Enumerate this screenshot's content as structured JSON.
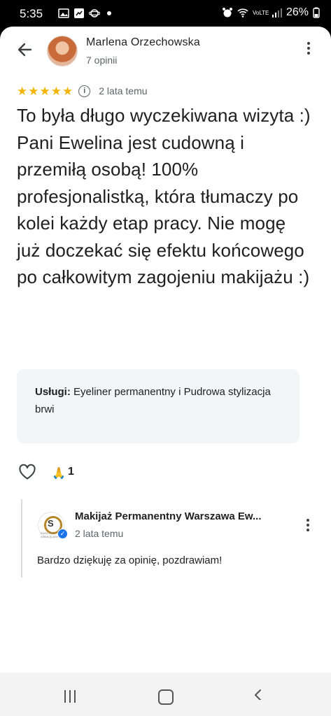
{
  "status_bar": {
    "time": "5:35",
    "battery": "26%",
    "network_label": "VoLTE"
  },
  "review": {
    "author_name": "Marlena Orzechowska",
    "author_meta": "7 opinii",
    "rating": 5,
    "stars": [
      "★",
      "★",
      "★",
      "★",
      "★"
    ],
    "date": "2 lata temu",
    "text": "To była długo wyczekiwana wizyta :) Pani Ewelina jest cudowną i przemiłą osobą! 100% profesjonalistką, która tłumaczy po kolei każdy etap pracy. Nie mogę już doczekać się efektu końcowego po całkowitym zagojeniu makijażu :)",
    "services_label": "Usługi:",
    "services_value": "Eyeliner permanentny i Pudrowa stylizacja brwi",
    "reaction_emoji": "🙏",
    "reaction_count": "1"
  },
  "reply": {
    "owner_name": "Makijaż Permanentny Warszawa Ew...",
    "date": "2 lata temu",
    "text": "Bardzo dziękuję za opinię, pozdrawiam!",
    "logo_initial": "S",
    "logo_caption": "EWELINA ANDRZEJEWSKA"
  },
  "colors": {
    "star": "#f4b400",
    "verified": "#1a73e8",
    "services_bg": "#f3f5f8"
  },
  "icons": {
    "back": "arrow-back-icon",
    "more": "more-vert-icon",
    "info": "info-icon",
    "like": "heart-icon",
    "verified": "verified-check-icon"
  }
}
